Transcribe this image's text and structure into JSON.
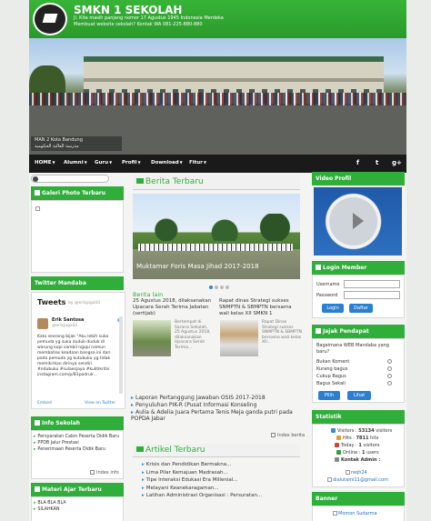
{
  "header": {
    "title": "SMKN 1 SEKOLAH",
    "address_line1": "Jl. Kita masih panjang nomor 17 Agustus 1945 Indonesia Merdeka",
    "address_line2": "Membuat website sekolah? Kontak WA 081-225-880-880"
  },
  "hero": {
    "caption_line1": "MAN 2 Kota Bandung",
    "caption_line2": "مدرسة العالية الحكومية"
  },
  "nav": {
    "items": [
      "HOME",
      "Alumni",
      "Guru",
      "Profil",
      "Download",
      "Fitur"
    ],
    "social": [
      "f",
      "t",
      "g+"
    ]
  },
  "left": {
    "galeri_title": "Galeri Photo Terbaru",
    "twitter_title": "Twitter Mandaba",
    "twitter": {
      "heading": "Tweets",
      "by": "by @erikjogalid",
      "name": "Erik Santosa",
      "handle": "@erikjogalid",
      "body": "Kata seorang bijak \"Aku lebih suka pemuda yg suka duduk-duduk di warung kopi sambil ngopi namun membahas keadaan bangsa ini dari pada pemuda yg kutubuku yg tidak memikirkan dirinya sendiri. #ndubuku #sulaesjaya #kulitikritis instagram.com/p/B1podrulr...",
      "embed": "Embed",
      "view": "View on Twitter"
    },
    "info_title": "Info Sekolah",
    "info_items": [
      "Persyaratan Calon Peserta Didik Baru",
      "PPDB Jalur Prestasi",
      "Penerimaan Peserta Didik Baru"
    ],
    "info_index": "Index info",
    "materi_title": "Materi Ajar Terbaru",
    "materi_items": [
      "BLA BLA BLA",
      "SILAHKAN"
    ]
  },
  "main": {
    "berita_title": "Berita Terbaru",
    "slider_caption": "Muktamar Foris Masa Jihad 2017-2018",
    "berita_lain": "Berita lain",
    "items": [
      {
        "title": "25 Agustus 2018, dilaksanakan Upacara Serah Terima Jabatan (sertijab)",
        "excerpt": "Bertempat di Sarana Sekolah, 25 Agustus 2018, dilaksanakan Upacara Serah Terima..."
      },
      {
        "title": "Rapat dinas Strategi sukses SNMPTN & SBMPTN bersama wali kelas XII SMKN 1",
        "excerpt": "Rapat Dinas Strategi sukses SNMPTN & SBMPTN bersama wali kelas XII..."
      }
    ],
    "links": [
      "Laporan Pertanggung Jawaban OSIS 2017-2018",
      "Penyuluhan PIK-R (Pusat Informasi Konseling",
      "Aulia & Adelia Juara Pertama Tenis Meja ganda putri pada POPDA Jabar"
    ],
    "index_berita": "Index berita",
    "artikel_title": "Artikel Terbaru",
    "artikel_items": [
      "Krisis dan Pendidikan Bermakna...",
      "Lima Pilar Kemajuan Madrasah...",
      "Tipe Interaksi Edukasi Era Millenial...",
      "Melayani Keanekaragaman...",
      "Latihan Administrasi Organisasi : Persuratan..."
    ]
  },
  "right": {
    "video_title": "Video Profil",
    "login_title": "Login Member",
    "username_label": "Username",
    "password_label": "Password",
    "login_btn": "Login",
    "daftar_btn": "Daftar",
    "poll_title": "Jajak Pendapat",
    "poll_question": "Bagaimana WEB Mandaba yang baru?",
    "poll_options": [
      "Bukan Koment",
      "Kurang bagus",
      "Cukup Bagus",
      "Bagus Sekali"
    ],
    "pilih_btn": "Pilih",
    "lihat_btn": "Lihat",
    "stat_title": "Statistik",
    "stats": [
      {
        "label": "Visitors : ",
        "value": "53134",
        "suffix": " visitors"
      },
      {
        "label": "Hits : ",
        "value": "7811",
        "suffix": " hits"
      },
      {
        "label": "Today : ",
        "value": "1",
        "suffix": " visitors"
      },
      {
        "label": "Online : ",
        "value": "1",
        "suffix": " users"
      },
      {
        "label": "",
        "value": "",
        "suffix": "Kontak Admin :"
      }
    ],
    "kontak": [
      "reqh24",
      "dialutami11@gmail.com"
    ],
    "banner_title": "Banner",
    "banner_item": "Momon Sudarma"
  },
  "colors": {
    "green": "#2fae3a",
    "dark_nav": "#1a1a1a",
    "blue": "#2a7fd0"
  }
}
